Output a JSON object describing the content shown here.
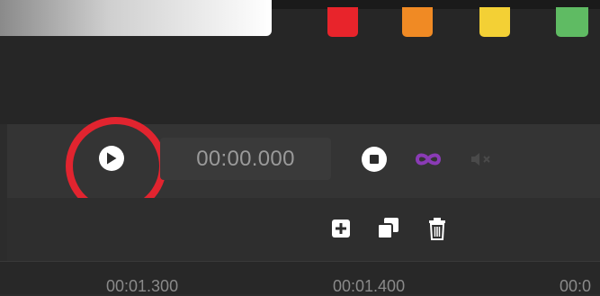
{
  "palette": {
    "gradient": [
      "#8a8a8a",
      "#ffffff"
    ],
    "swatches": [
      "#e8242b",
      "#f08a24",
      "#f3d035",
      "#5fbb63"
    ]
  },
  "player": {
    "time": "00:00.000",
    "play_icon": "play-icon",
    "stop_icon": "stop-icon",
    "loop_icon": "infinity-loop-icon",
    "loop_color": "#8a3bb5",
    "mute_icon": "mute-icon"
  },
  "actions": {
    "add_icon": "add-icon",
    "duplicate_icon": "duplicate-icon",
    "delete_icon": "trash-icon"
  },
  "timeline": {
    "ticks": [
      "00:01.300",
      "00:01.400",
      "00:0"
    ]
  },
  "annotation": {
    "highlight_color": "#e1242f"
  }
}
